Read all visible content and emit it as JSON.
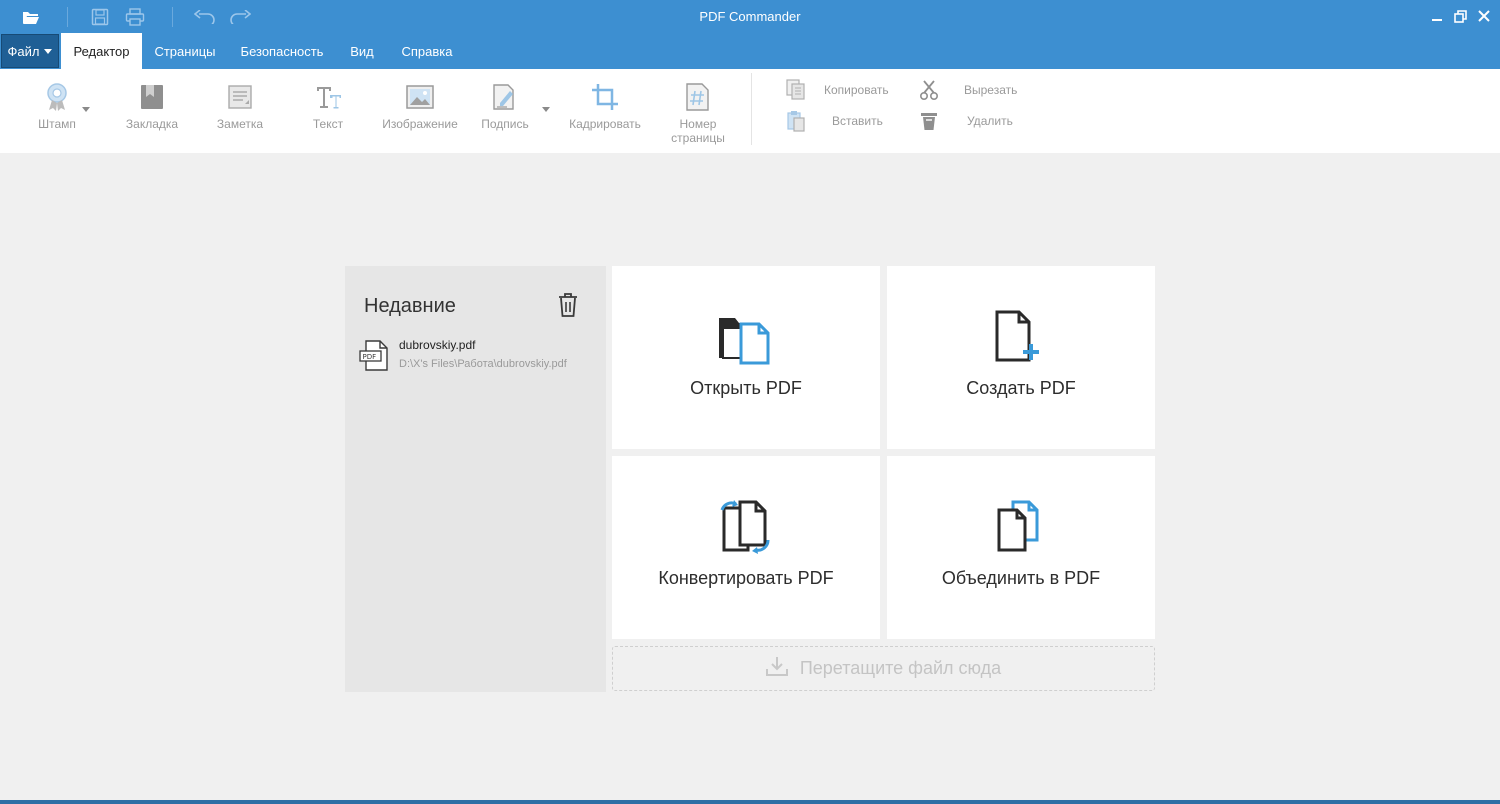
{
  "app": {
    "title": "PDF Commander"
  },
  "menu": {
    "file": "Файл",
    "tabs": [
      "Редактор",
      "Страницы",
      "Безопасность",
      "Вид",
      "Справка"
    ]
  },
  "ribbon": {
    "tools": [
      {
        "label": "Штамп",
        "icon": "stamp-icon"
      },
      {
        "label": "Закладка",
        "icon": "bookmark-icon"
      },
      {
        "label": "Заметка",
        "icon": "note-icon"
      },
      {
        "label": "Текст",
        "icon": "text-icon"
      },
      {
        "label": "Изображение",
        "icon": "image-icon"
      },
      {
        "label": "Подпись",
        "icon": "signature-icon"
      },
      {
        "label": "Кадрировать",
        "icon": "crop-icon"
      },
      {
        "label": "Номер\nстраницы",
        "icon": "page-number-icon"
      }
    ],
    "clipboard": {
      "copy": "Копировать",
      "paste": "Вставить",
      "cut": "Вырезать",
      "delete": "Удалить"
    }
  },
  "recent": {
    "title": "Недавние",
    "files": [
      {
        "name": "dubrovskiy.pdf",
        "path": "D:\\X's Files\\Работа\\dubrovskiy.pdf"
      }
    ]
  },
  "actions": {
    "open": "Открыть PDF",
    "create": "Создать PDF",
    "convert": "Конвертировать PDF",
    "merge": "Объединить в PDF"
  },
  "dropzone": {
    "text": "Перетащите файл сюда"
  },
  "colors": {
    "titlebar": "#3d8fd1",
    "file_tab": "#1f5f95",
    "accent_icon": "#3a9ad9"
  }
}
